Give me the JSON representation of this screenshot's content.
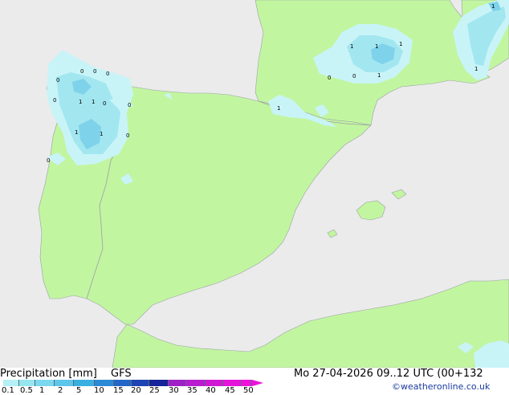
{
  "footer": {
    "title": "Precipitation [mm]",
    "model": "GFS",
    "datetime": "Mo 27-04-2026 09..12 UTC (00+132",
    "credit": "©weatheronline.co.uk"
  },
  "legend": {
    "ticks": [
      "0.1",
      "0.5",
      "1",
      "2",
      "5",
      "10",
      "15",
      "20",
      "25",
      "30",
      "35",
      "40",
      "45",
      "50"
    ],
    "colors": [
      "#b4f0f5",
      "#96e6f0",
      "#7cd8ee",
      "#5ec6ea",
      "#3ab0e0",
      "#2b8ad6",
      "#2466c8",
      "#1e44b4",
      "#15249a",
      "#a020c8",
      "#b81ed0",
      "#d018d4",
      "#e414d8",
      "#f010dc"
    ]
  },
  "map": {
    "colors": {
      "land": "#c2f5a0",
      "sea": "#ebebeb",
      "border": "#9aa0a8",
      "light_precip": "#c8f4f8",
      "mid_precip": "#a2e6f0",
      "core_precip": "#7ed2ea"
    },
    "contour_labels": [
      "0",
      "0",
      "0",
      "0",
      "0",
      "1",
      "1",
      "0",
      "0",
      "1",
      "1",
      "0",
      "1",
      "1",
      "1",
      "0",
      "0",
      "1",
      "1",
      "1",
      "0",
      "1"
    ]
  }
}
